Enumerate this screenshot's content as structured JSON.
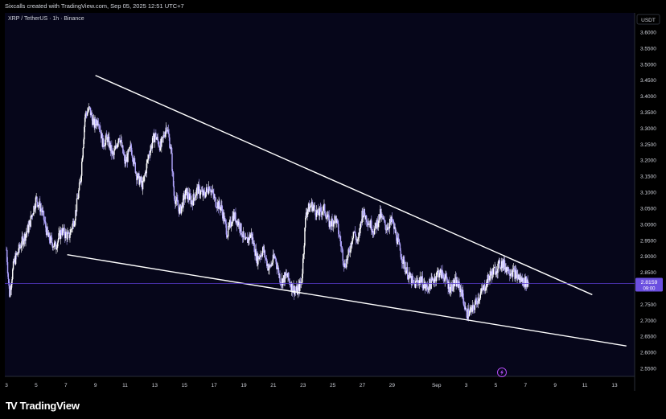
{
  "header": {
    "credit": "Sixcalls created with TradingView.com, Sep 05, 2025 12:51 UTC+7",
    "symbol": "XRP / TetherUS · 1h · Binance"
  },
  "chart_data": {
    "type": "candlestick",
    "symbol": "XRP / TetherUS",
    "interval": "1h",
    "exchange": "Binance",
    "currency": "USDT",
    "ylim": [
      2.5,
      3.62
    ],
    "y_ticks": [
      3.6,
      3.55,
      3.5,
      3.45,
      3.4,
      3.35,
      3.3,
      3.25,
      3.2,
      3.15,
      3.1,
      3.05,
      3.0,
      2.95,
      2.9,
      2.85,
      2.8,
      2.75,
      2.7,
      2.65,
      2.6,
      2.55
    ],
    "y_tick_labels": [
      "3.6000",
      "3.5500",
      "3.5000",
      "3.4500",
      "3.4000",
      "3.3500",
      "3.3000",
      "3.2500",
      "3.2000",
      "3.1500",
      "3.1000",
      "3.0500",
      "3.0000",
      "2.9500",
      "2.9000",
      "2.8500",
      "2.8000",
      "2.7500",
      "2.7000",
      "2.6500",
      "2.6000",
      "2.5500"
    ],
    "x_ticks": [
      3,
      5,
      7,
      9,
      11,
      13,
      15,
      17,
      19,
      21,
      23,
      25,
      27,
      29,
      33,
      35,
      37,
      39,
      41,
      43
    ],
    "x_tick_labels": [
      "3",
      "5",
      "7",
      "9",
      "11",
      "13",
      "15",
      "17",
      "19",
      "21",
      "23",
      "25",
      "27",
      "29",
      "Sep",
      "3",
      "5",
      "7",
      "9",
      "11",
      "13"
    ],
    "xlim": [
      3,
      44
    ],
    "price_path": [
      [
        3.0,
        2.92
      ],
      [
        3.2,
        2.78
      ],
      [
        3.5,
        2.88
      ],
      [
        4.0,
        2.94
      ],
      [
        4.5,
        2.99
      ],
      [
        5.0,
        3.08
      ],
      [
        5.4,
        3.04
      ],
      [
        5.8,
        2.96
      ],
      [
        6.3,
        2.93
      ],
      [
        6.7,
        2.98
      ],
      [
        7.2,
        2.96
      ],
      [
        7.6,
        3.02
      ],
      [
        8.0,
        3.14
      ],
      [
        8.3,
        3.34
      ],
      [
        8.6,
        3.36
      ],
      [
        8.9,
        3.31
      ],
      [
        9.2,
        3.33
      ],
      [
        9.5,
        3.25
      ],
      [
        9.8,
        3.27
      ],
      [
        10.2,
        3.21
      ],
      [
        10.6,
        3.28
      ],
      [
        11.0,
        3.19
      ],
      [
        11.4,
        3.24
      ],
      [
        11.8,
        3.15
      ],
      [
        12.2,
        3.12
      ],
      [
        12.6,
        3.22
      ],
      [
        13.0,
        3.28
      ],
      [
        13.4,
        3.24
      ],
      [
        13.8,
        3.31
      ],
      [
        14.1,
        3.23
      ],
      [
        14.3,
        3.09
      ],
      [
        14.7,
        3.04
      ],
      [
        15.1,
        3.1
      ],
      [
        15.5,
        3.07
      ],
      [
        15.9,
        3.11
      ],
      [
        16.3,
        3.09
      ],
      [
        16.7,
        3.12
      ],
      [
        17.1,
        3.07
      ],
      [
        17.5,
        3.05
      ],
      [
        17.9,
        2.97
      ],
      [
        18.3,
        3.03
      ],
      [
        18.7,
        3.0
      ],
      [
        19.1,
        2.94
      ],
      [
        19.5,
        2.97
      ],
      [
        19.9,
        2.89
      ],
      [
        20.3,
        2.92
      ],
      [
        20.7,
        2.86
      ],
      [
        21.1,
        2.9
      ],
      [
        21.5,
        2.82
      ],
      [
        21.9,
        2.84
      ],
      [
        22.3,
        2.8
      ],
      [
        22.6,
        2.79
      ],
      [
        22.9,
        2.82
      ],
      [
        23.2,
        3.04
      ],
      [
        23.6,
        3.06
      ],
      [
        24.0,
        3.03
      ],
      [
        24.4,
        3.05
      ],
      [
        24.8,
        3.0
      ],
      [
        25.2,
        3.02
      ],
      [
        25.5,
        2.95
      ],
      [
        25.8,
        2.87
      ],
      [
        26.1,
        2.91
      ],
      [
        26.4,
        2.98
      ],
      [
        26.7,
        2.94
      ],
      [
        27.0,
        3.04
      ],
      [
        27.4,
        3.01
      ],
      [
        27.8,
        2.98
      ],
      [
        28.2,
        3.03
      ],
      [
        28.6,
        2.99
      ],
      [
        29.0,
        3.01
      ],
      [
        29.3,
        2.96
      ],
      [
        29.7,
        2.89
      ],
      [
        30.1,
        2.84
      ],
      [
        30.5,
        2.81
      ],
      [
        30.9,
        2.83
      ],
      [
        31.3,
        2.8
      ],
      [
        31.7,
        2.82
      ],
      [
        32.1,
        2.85
      ],
      [
        32.5,
        2.84
      ],
      [
        32.9,
        2.8
      ],
      [
        33.3,
        2.82
      ],
      [
        33.7,
        2.79
      ],
      [
        34.0,
        2.72
      ],
      [
        34.4,
        2.73
      ],
      [
        34.8,
        2.77
      ],
      [
        35.2,
        2.8
      ],
      [
        35.6,
        2.84
      ],
      [
        36.0,
        2.86
      ],
      [
        36.4,
        2.88
      ],
      [
        36.8,
        2.86
      ],
      [
        37.2,
        2.85
      ],
      [
        37.6,
        2.83
      ],
      [
        37.9,
        2.82
      ],
      [
        38.2,
        2.82
      ]
    ],
    "trendlines": [
      {
        "name": "upper",
        "x": [
          9.0,
          42.5
        ],
        "y": [
          3.465,
          2.78
        ]
      },
      {
        "name": "lower",
        "x": [
          7.1,
          44.8
        ],
        "y": [
          2.905,
          2.62
        ]
      }
    ],
    "horizontal_line": {
      "y": 2.815
    },
    "current_price": {
      "value": "2.8159",
      "countdown": "09:00"
    }
  },
  "axis": {
    "currency_label": "USDT"
  },
  "footer": {
    "brand": "TradingView",
    "logo": "TV"
  },
  "colors": {
    "background": "#000000",
    "pane": "#06061a",
    "candle": "#b2a6ff",
    "candle_alt": "#ffffff",
    "trendline": "#ffffff",
    "price_line": "#5a3ccf",
    "price_label": "#6b4fe0",
    "axis_text": "#d1d4dc"
  }
}
